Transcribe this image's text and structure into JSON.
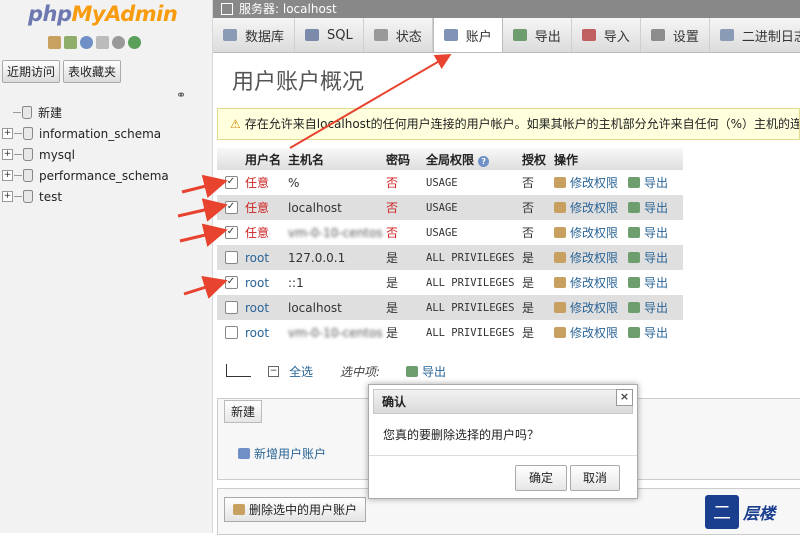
{
  "app": {
    "logo_php": "php",
    "logo_myadmin": "MyAdmin"
  },
  "nav": {
    "tabs": [
      "近期访问",
      "表收藏夹"
    ],
    "new_label": "新建",
    "databases": [
      "information_schema",
      "mysql",
      "performance_schema",
      "test"
    ]
  },
  "topbar": {
    "server_label": "服务器:",
    "server_name": "localhost"
  },
  "tabs": [
    {
      "label": "数据库",
      "icon": "database-icon",
      "color": "#8a9bb5"
    },
    {
      "label": "SQL",
      "icon": "sql-icon",
      "color": "#7a8aa8"
    },
    {
      "label": "状态",
      "icon": "status-icon",
      "color": "#999999"
    },
    {
      "label": "账户",
      "icon": "accounts-icon",
      "color": "#7f93b6"
    },
    {
      "label": "导出",
      "icon": "export-icon",
      "color": "#6e9e6e"
    },
    {
      "label": "导入",
      "icon": "import-icon",
      "color": "#c06060"
    },
    {
      "label": "设置",
      "icon": "settings-icon",
      "color": "#8c8c8c"
    },
    {
      "label": "二进制日志",
      "icon": "binlog-icon",
      "color": "#8a9bb5"
    }
  ],
  "page": {
    "title": "用户账户概况"
  },
  "notice": {
    "text": "存在允许来自localhost的任何用户连接的用户帐户。如果其帐户的主机部分允许来自任何（%）主机的连接"
  },
  "table": {
    "headers": {
      "user": "用户名",
      "host": "主机名",
      "password": "密码",
      "global_priv": "全局权限",
      "grant": "授权",
      "actions": "操作"
    },
    "rows": [
      {
        "checked": true,
        "user": "任意",
        "host": "%",
        "password": "否",
        "privileges": "USAGE",
        "grant": "否",
        "edit": "修改权限",
        "export": "导出"
      },
      {
        "checked": true,
        "user": "任意",
        "host": "localhost",
        "password": "否",
        "privileges": "USAGE",
        "grant": "否",
        "edit": "修改权限",
        "export": "导出"
      },
      {
        "checked": true,
        "user": "任意",
        "host": "vm-0-10-centos",
        "password": "否",
        "privileges": "USAGE",
        "grant": "否",
        "edit": "修改权限",
        "export": "导出"
      },
      {
        "checked": false,
        "user": "root",
        "host": "127.0.0.1",
        "password": "是",
        "privileges": "ALL PRIVILEGES",
        "grant": "是",
        "edit": "修改权限",
        "export": "导出"
      },
      {
        "checked": true,
        "user": "root",
        "host": "::1",
        "password": "是",
        "privileges": "ALL PRIVILEGES",
        "grant": "是",
        "edit": "修改权限",
        "export": "导出"
      },
      {
        "checked": false,
        "user": "root",
        "host": "localhost",
        "password": "是",
        "privileges": "ALL PRIVILEGES",
        "grant": "是",
        "edit": "修改权限",
        "export": "导出"
      },
      {
        "checked": false,
        "user": "root",
        "host": "vm-0-10-centos",
        "password": "是",
        "privileges": "ALL PRIVILEGES",
        "grant": "是",
        "edit": "修改权限",
        "export": "导出"
      }
    ]
  },
  "bulk": {
    "select_all": "全选",
    "with_selected": "选中项:",
    "export": "导出"
  },
  "new_section": {
    "header": "新建",
    "add_user": "新增用户账户"
  },
  "delete_section": {
    "button": "删除选中的用户账户"
  },
  "dialog": {
    "title": "确认",
    "message": "您真的要删除选择的用户吗？",
    "ok": "确定",
    "cancel": "取消",
    "close": "×"
  },
  "watermark": {
    "text": "层楼"
  },
  "colors": {
    "annotation_arrow": "#e8432e",
    "link": "#2a6496",
    "anonymous_user": "#cc2222"
  }
}
